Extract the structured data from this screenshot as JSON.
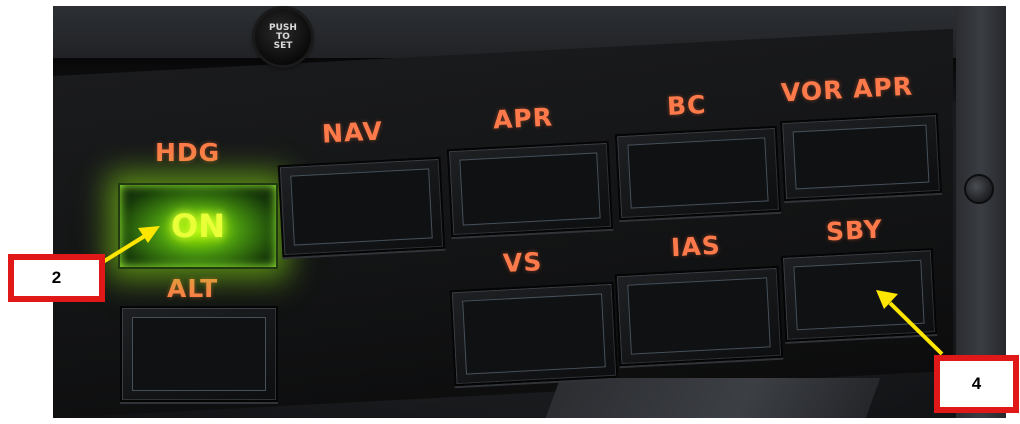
{
  "panel": {
    "knob_text": [
      "PUSH",
      "TO",
      "SET"
    ],
    "labels": {
      "hdg": "HDG",
      "nav": "NAV",
      "apr": "APR",
      "bc": "BC",
      "vor_apr": "VOR APR",
      "alt": "ALT",
      "vs": "VS",
      "ias": "IAS",
      "sby": "SBY"
    },
    "hdg_indicator": "ON"
  },
  "callouts": {
    "left": "2",
    "right": "4"
  },
  "colors": {
    "label_orange": "#ff7a4a",
    "indicator_green": "#b6ff10",
    "callout_red": "#e01818",
    "arrow_yellow": "#ffe600"
  }
}
